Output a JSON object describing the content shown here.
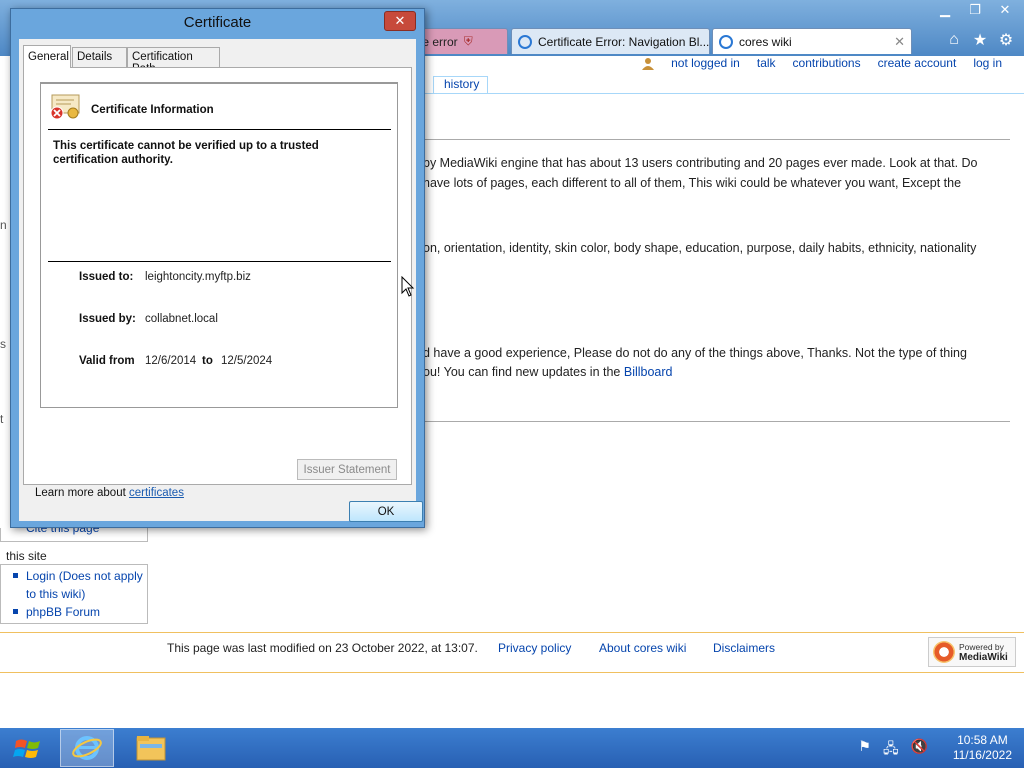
{
  "browser": {
    "window_controls": {
      "minimize": "▁",
      "restore": "❐",
      "close": "✕"
    },
    "tabs": [
      {
        "label": "te error",
        "icon": "shield-error-icon",
        "state": "error"
      },
      {
        "label": "Certificate Error: Navigation Bl...",
        "icon": "ie-icon",
        "state": "inactive"
      },
      {
        "label": "cores wiki",
        "icon": "ie-icon",
        "state": "active",
        "close": "✕"
      }
    ],
    "toolbar_icons": [
      "home-icon",
      "favorites-star-icon",
      "settings-gear-icon"
    ]
  },
  "wiki": {
    "personal_links": [
      "not logged in",
      "talk",
      "contributions",
      "create account",
      "log in"
    ],
    "history_tab": "history",
    "paragraphs": {
      "p1_line1": "by MediaWiki engine that has about 13 users contributing and 20 pages ever made. Look at that. Do",
      "p1_line2": "have lots of pages, each different to all of them, This wiki could be whatever you want, Except the",
      "p2_line1": "on, orientation, identity, skin color, body shape, education, purpose, daily habits, ethnicity, nationality",
      "p3_line1": "d have a good experience, Please do not do any of the things above, Thanks. Not the type of thing",
      "p3_line2_pre": "ou! You can find new updates in the ",
      "p3_line2_link": "Billboard"
    },
    "sidebar": {
      "cite_link": "Cite this page",
      "site_label": "this site",
      "site_links": [
        "Login (Does not apply",
        "to this wiki)",
        "phpBB Forum"
      ],
      "fragments": [
        "n",
        "s",
        "t"
      ]
    },
    "footer": {
      "last_modified": "This page was last modified on 23 October 2022, at 13:07.",
      "links": [
        "Privacy policy",
        "About cores wiki",
        "Disclaimers"
      ],
      "badge_line1": "Powered by",
      "badge_line2": "MediaWiki"
    }
  },
  "dialog": {
    "title": "Certificate",
    "close": "✕",
    "tabs": [
      "General",
      "Details",
      "Certification Path"
    ],
    "info_title": "Certificate Information",
    "warning": "This certificate cannot be verified up to a trusted certification authority.",
    "issued_to_label": "Issued to:",
    "issued_to": "leightoncity.myftp.biz",
    "issued_by_label": "Issued by:",
    "issued_by": "collabnet.local",
    "valid_from_label": "Valid from",
    "valid_from": "12/6/2014",
    "valid_to_label": "to",
    "valid_to": "12/5/2024",
    "issuer_statement_button": "Issuer Statement",
    "learn_more_text": "Learn more about ",
    "learn_more_link": "certificates",
    "ok_button": "OK"
  },
  "taskbar": {
    "pinned": [
      "internet-explorer-icon",
      "file-explorer-icon"
    ],
    "tray_icons": [
      "action-center-flag-icon",
      "network-icon",
      "volume-muted-icon"
    ],
    "time": "10:58 AM",
    "date": "11/16/2022"
  }
}
